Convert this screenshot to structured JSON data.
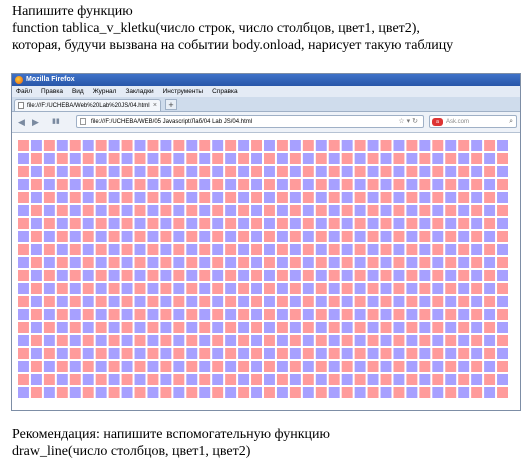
{
  "task": {
    "line1": "Напишите функцию",
    "line2": "function tablica_v_kletku(число строк, число столбцов, цвет1, цвет2),",
    "line3": "которая, будучи вызвана на событии body.onload, нарисует такую таблицу"
  },
  "browser": {
    "window_title": "Mozilla Firefox",
    "menu": [
      "Файл",
      "Правка",
      "Вид",
      "Журнал",
      "Закладки",
      "Инструменты",
      "Справка"
    ],
    "tab_title": "file:///F:/UCHEBA/Web%20Lab%20JS/04.html",
    "url": "file:///F:/UCHEBA/WEB/05 Javascript/Лаб/04 Lab JS/04.html",
    "search_placeholder": "Ask.com",
    "icons": [
      "firefox-logo-icon",
      "back-icon",
      "forward-icon",
      "star-icon",
      "reload-icon",
      "search-icon",
      "close-icon",
      "new-tab-icon"
    ]
  },
  "table": {
    "rows": 20,
    "cols": 38,
    "color1": "#ff9b9b",
    "color2": "#a7a0ff"
  },
  "recommendation": {
    "line1": "Рекомендация: напишите вспомогательную функцию",
    "line2": "draw_line(число столбцов, цвет1, цвет2)"
  }
}
